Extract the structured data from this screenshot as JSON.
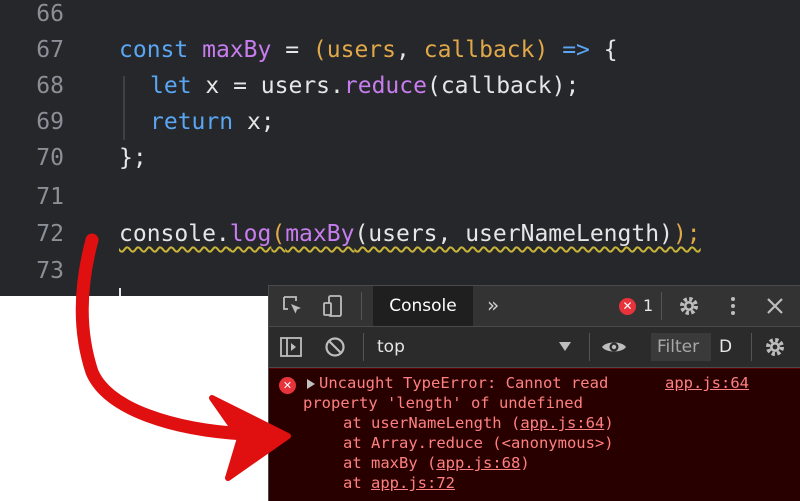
{
  "editor": {
    "lines": [
      {
        "num": "66"
      },
      {
        "num": "67"
      },
      {
        "num": "68"
      },
      {
        "num": "69"
      },
      {
        "num": "70"
      },
      {
        "num": "71"
      },
      {
        "num": "72"
      },
      {
        "num": "73"
      }
    ],
    "code": {
      "l67": {
        "kw": "const",
        "name": "maxBy",
        "eq": " = ",
        "open": "(",
        "p1": "users",
        "comma": ", ",
        "p2": "callback",
        "close": ")",
        "arrow": " =>",
        "brace": " {"
      },
      "l68": {
        "kw": "let",
        "rest1": " x = users.",
        "fn": "reduce",
        "rest2": "(callback);"
      },
      "l69": {
        "kw": "return",
        "rest": " x;"
      },
      "l70": {
        "text": "};"
      },
      "l72": {
        "obj": "console.",
        "fn1": "log",
        "open": "(",
        "fn2": "maxBy",
        "args": "(users, userNameLength)",
        "close": ");"
      }
    }
  },
  "devtools": {
    "tab_console": "Console",
    "tab_more": "»",
    "error_count": "1",
    "context": "top",
    "filter_placeholder": "Filter",
    "levels_label": "D",
    "error": {
      "line1": "Uncaught TypeError: Cannot read",
      "line2": "property 'length' of undefined",
      "source": "app.js:64",
      "stack": [
        {
          "prefix": "at userNameLength (",
          "link": "app.js:64",
          "suffix": ")"
        },
        {
          "prefix": "at Array.reduce (<anonymous>)",
          "link": "",
          "suffix": ""
        },
        {
          "prefix": "at maxBy (",
          "link": "app.js:68",
          "suffix": ")"
        },
        {
          "prefix": "at ",
          "link": "app.js:72",
          "suffix": ""
        }
      ]
    }
  },
  "colors": {
    "editor_bg": "#25272b",
    "keyword": "#5aa6f2",
    "function": "#c77dee",
    "param": "#e1a84a",
    "error_text": "#ff8080",
    "error_bg": "#290000",
    "annotation": "#e01010"
  },
  "icons": [
    "inspect-icon",
    "device-icon",
    "more-tabs-icon",
    "error-icon",
    "gear-icon",
    "kebab-icon",
    "close-icon",
    "sidebar-icon",
    "clear-icon",
    "eye-icon",
    "settings-icon",
    "dropdown-arrow-icon"
  ]
}
